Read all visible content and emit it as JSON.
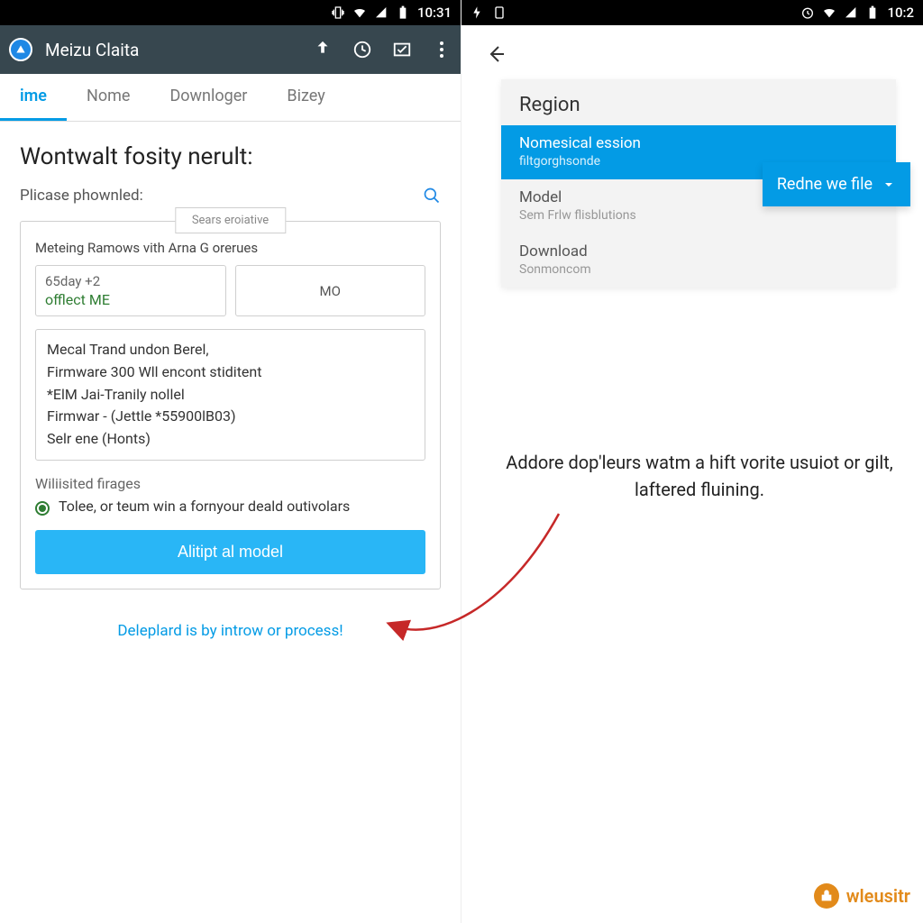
{
  "statusbar": {
    "time_left": "10:31",
    "time_right": "10:2"
  },
  "appbar": {
    "title": "Meizu Claita"
  },
  "tabs": [
    "ime",
    "Nome",
    "Downloger",
    "Bizey"
  ],
  "left": {
    "headline": "Wontwalt fosity nerult:",
    "label": "Plicase phownled:",
    "pill": "Sears eroiative",
    "card_sub": "Meteing Ramows vith Arna G orerues",
    "field1_top": "65day +2",
    "field1_bot": "offlect ME",
    "field2": "MO",
    "list": [
      "Mecal Trand undon Berel,",
      "Firmware 300 Wll encont stiditent",
      "*ElM Jai-Tranily nollel",
      "Firmwar - (Jettle *55900lB03)",
      "Selr ene (Honts)"
    ],
    "section": "Wiliisited firages",
    "check": "Tolee, or teum win a fornyour deald outivolars",
    "cta": "Alitipt al model",
    "footer": "Deleplard is by introw or process!"
  },
  "right": {
    "sheet_head": "Region",
    "options": [
      {
        "t1": "Nomesical ession",
        "t2": "filtgorghsonde",
        "selected": true
      },
      {
        "t1": "Model",
        "t2": "Sem Frlw flisblutions",
        "selected": false
      },
      {
        "t1": "Download",
        "t2": "Sonmoncom",
        "selected": false
      }
    ],
    "drop_btn": "Redne we file",
    "caption": "Addore dop'leurs watm a hift vorite usuiot or gilt, laftered fluining."
  },
  "watermark": "wleusitr"
}
